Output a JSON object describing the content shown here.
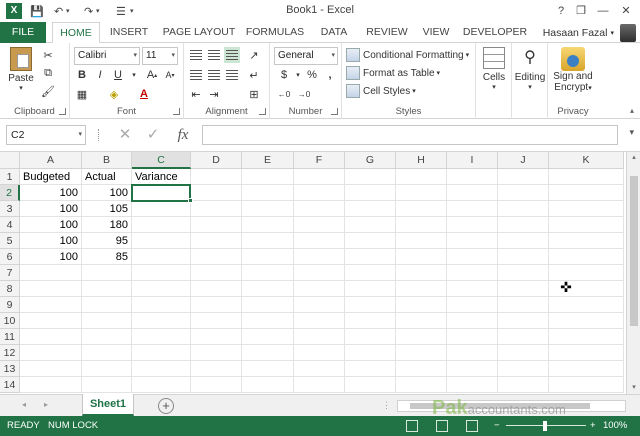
{
  "window": {
    "title": "Book1 - Excel",
    "user_name": "Hasaan Fazal",
    "help": "?",
    "minimize": "—",
    "restore": "❐",
    "close": "✕"
  },
  "tabs": [
    "FILE",
    "HOME",
    "INSERT",
    "PAGE LAYOUT",
    "FORMULAS",
    "DATA",
    "REVIEW",
    "VIEW",
    "DEVELOPER"
  ],
  "active_tab": "HOME",
  "ribbon": {
    "clipboard": {
      "label": "Clipboard",
      "paste": "Paste"
    },
    "font": {
      "label": "Font",
      "font_name": "Calibri",
      "font_size": "11",
      "bold": "B",
      "italic": "I",
      "underline": "U"
    },
    "alignment": {
      "label": "Alignment"
    },
    "number": {
      "label": "Number",
      "format": "General",
      "currency": "$",
      "percent": "%",
      "comma": ","
    },
    "styles": {
      "label": "Styles",
      "conditional": "Conditional Formatting",
      "format_table": "Format as Table",
      "cell_styles": "Cell Styles"
    },
    "cells": {
      "label": "Cells"
    },
    "editing": {
      "label": "Editing"
    },
    "privacy": {
      "label": "Privacy",
      "sign_line1": "Sign and",
      "sign_line2": "Encrypt"
    }
  },
  "formula_bar": {
    "name_box": "C2",
    "cancel": "✕",
    "enter": "✓",
    "fx": "fx",
    "formula": ""
  },
  "columns": [
    "A",
    "B",
    "C",
    "D",
    "E",
    "F",
    "G",
    "H",
    "I",
    "J",
    "K"
  ],
  "rows": [
    "1",
    "2",
    "3",
    "4",
    "5",
    "6",
    "7",
    "8",
    "9",
    "10",
    "11",
    "12",
    "13",
    "14"
  ],
  "cells": {
    "A1": "Budgeted",
    "B1": "Actual",
    "C1": "Variance",
    "A2": "100",
    "B2": "100",
    "A3": "100",
    "B3": "105",
    "A4": "100",
    "B4": "180",
    "A5": "100",
    "B5": "95",
    "A6": "100",
    "B6": "85"
  },
  "selected_cell": "C2",
  "sheets": [
    "Sheet1"
  ],
  "status": {
    "mode": "READY",
    "numlock": "NUM LOCK",
    "zoom": "100%",
    "zoom_minus": "−",
    "zoom_plus": "+"
  },
  "watermark": {
    "brand": "Pak",
    "site": "accountants.com"
  },
  "colors": {
    "accent": "#217346"
  }
}
